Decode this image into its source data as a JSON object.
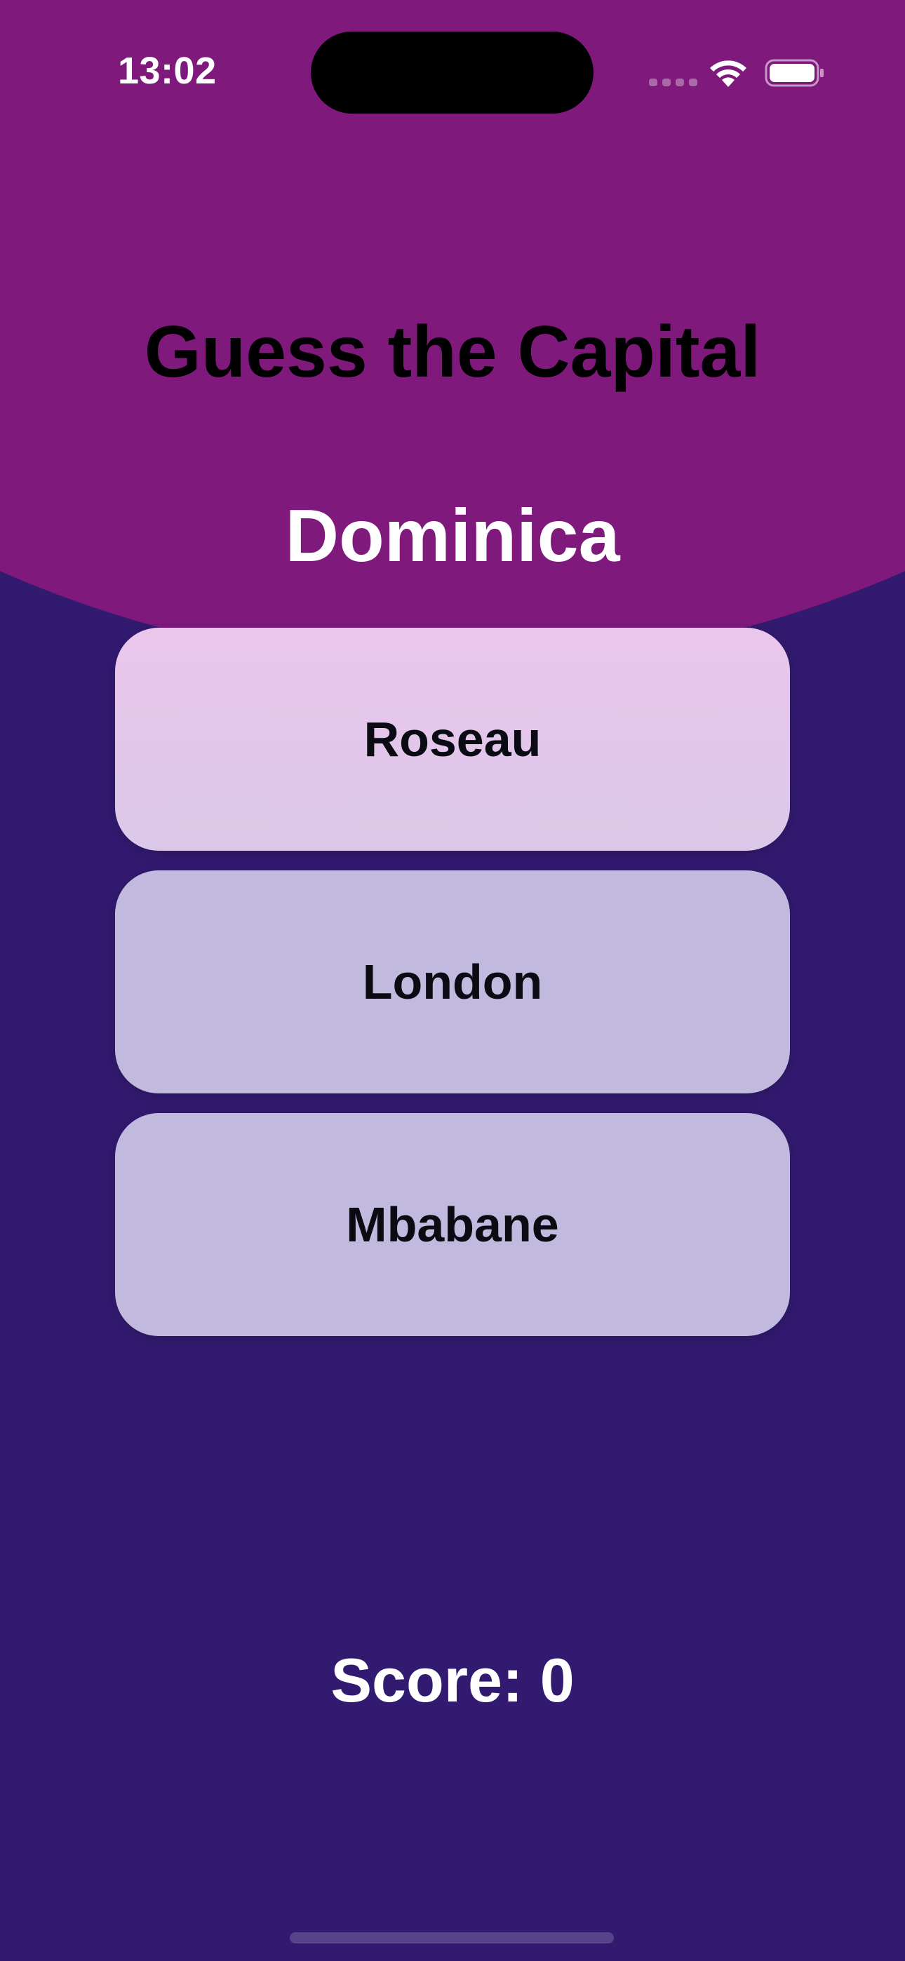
{
  "status_bar": {
    "time": "13:02",
    "icons": [
      "cellular-signal-icon",
      "wifi-icon",
      "battery-icon"
    ]
  },
  "game": {
    "title": "Guess the Capital",
    "country": "Dominica",
    "answers": [
      {
        "label": "Roseau"
      },
      {
        "label": "London"
      },
      {
        "label": "Mbabane"
      }
    ],
    "score_text": "Score: 0"
  },
  "colors": {
    "top_background": "#7f1a7c",
    "bottom_background": "#321a70",
    "button_fill": "#d4cde8",
    "button_highlight": "#ebc6ec"
  }
}
